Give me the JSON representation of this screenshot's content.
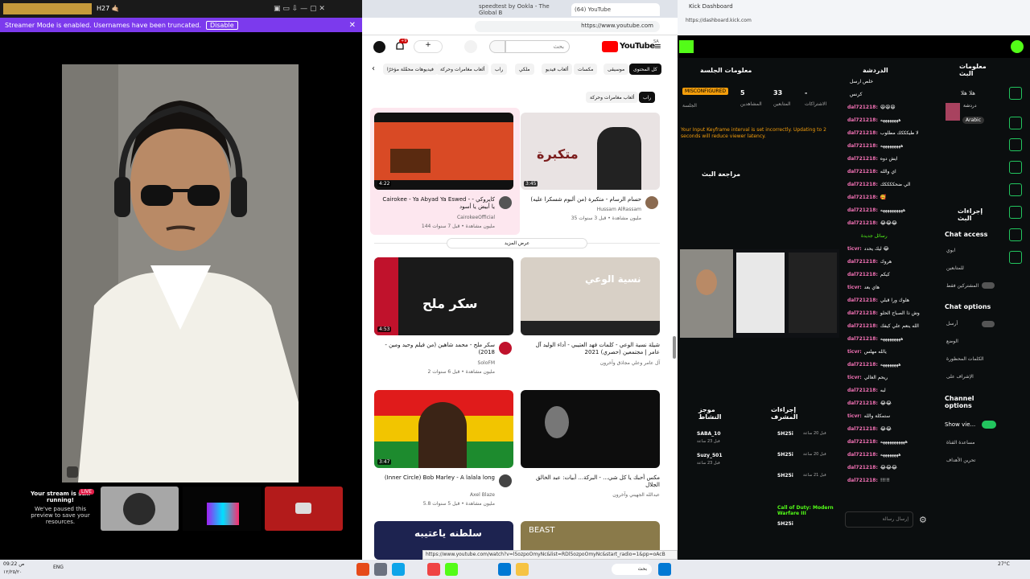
{
  "studio": {
    "title": "H27 🤙🏼",
    "banner": "Streamer Mode is enabled. Usernames have been truncated.",
    "disable": "Disable",
    "stream_msg_title": "Your stream is still running!",
    "stream_msg_body": "We've paused this preview to save your resources.",
    "live": "LIVE"
  },
  "browser": {
    "tabs": [
      "speedtest by Ookla - The Global B",
      "(64) YouTube"
    ],
    "url": "https://www.youtube.com",
    "search_placeholder": "بحث",
    "bell_count": "+9",
    "yt_logo": "YouTube",
    "yt_sup": "SA",
    "chips": [
      "كل المحتوى",
      "موسيقى",
      "مكسات",
      "ألعاب فيديو",
      "ملكي",
      "راب",
      "ألعاب مغامرات وحركة",
      "فيديوهات محمَّلة مؤخرًا"
    ],
    "subchips": [
      "راب",
      "ألعاب مغامرات وحركة"
    ],
    "show_more": "عرض المزيد",
    "videos": [
      {
        "title": "Cairokee - Ya Abyad Ya Eswed - كايروكي - يا أبيض يا أسود",
        "channel": "CairokeeOfficial",
        "meta": "144 مليون مشاهدة • قبل 7 سنوات",
        "dur": "4:22"
      },
      {
        "title": "حسام الرسام - متكبرة (من ألبوم شسكرا عليه)",
        "channel": "Hussam AlRassam",
        "meta": "35 مليون مشاهدة • قبل 3 سنوات",
        "dur": "3:45"
      },
      {
        "title": "سكر ملح - محمد شاهين (من فيلم وحيد ومين - 2018)",
        "channel": "SoloFM",
        "meta": "2 مليون مشاهدة • قبل 6 سنوات",
        "dur": "4:53"
      },
      {
        "title": "شيلة نسية الوعي - كلمات فهد العتيبي - أداء الوليد آل عامر | مجتمعين (حصري) 2021",
        "channel": "آل عامر وعلي مجاذق وآخرون",
        "meta": "",
        "dur": ""
      },
      {
        "title": "(Inner Circle) Bob Marley - A lalala long",
        "channel": "Axel Blaze",
        "meta": "5.8 مليون مشاهدة • قبل 5 سنوات",
        "dur": "3:47"
      },
      {
        "title": "مكس أحبك يا كل شي... - البركة... أبيات: عبد الخالق الجلال",
        "channel": "عبدالله الجهيني وآخرون",
        "meta": "",
        "dur": ""
      }
    ],
    "status_url": "https://www.youtube.com/watch?v=l5ozpoOmyNc&list=RDl5ozpoOmyNc&start_radio=1&pp=oAcB",
    "thumb_texts": [
      "متكبرة",
      "سكر ملح",
      "نسية الوعي",
      "سلطنه ياعتيبه",
      "BEAST"
    ]
  },
  "kick": {
    "tab_title": "Kick Dashboard",
    "url": "https://dashboard.kick.com",
    "session_title": "معلومات الجلسة",
    "chat_title": "الدردشة",
    "stream_info_title": "معلومات البث",
    "misconfigured": "MISCONFIGURED",
    "stat_viewers": "5",
    "stat_viewers_label": "المشاهدين",
    "stat_followers": "33",
    "stat_followers_label": "المتابعين",
    "stat_subs": "-",
    "stat_subs_label": "الاشتراكات",
    "session_label": "الجلسة",
    "warning": "Your Input Keyframe interval is set incorrectly. Updating to 2 seconds will reduce viewer latency.",
    "review_title": "مراجعة البث",
    "stream_title": "هلا هلا",
    "category": "دردشة",
    "lang": "Arabic",
    "chat_messages": [
      {
        "u": "",
        "t": "خلص ارسل"
      },
      {
        "u": "",
        "t": "كرنس"
      },
      {
        "u": "dal721218:",
        "t": "😆😆😆"
      },
      {
        "u": "dal721218:",
        "t": "ههههههههه"
      },
      {
        "u": "dal721218:",
        "t": "لا طيكككك مطلوب"
      },
      {
        "u": "dal721218:",
        "t": "هههههههههه"
      },
      {
        "u": "dal721218:",
        "t": "ايش دوه"
      },
      {
        "u": "dal721218:",
        "t": "اي والله"
      },
      {
        "u": "dal721218:",
        "t": "الي ضحككككك"
      },
      {
        "u": "dal721218:",
        "t": "🥰"
      },
      {
        "u": "dal721218:",
        "t": "ههههههههههه"
      },
      {
        "u": "dal721218:",
        "t": "😂😂😂"
      }
    ],
    "new_msgs": "رسائل جديدة",
    "chat_messages2": [
      {
        "u": "ticvr:",
        "t": "ليك يحدد 😂"
      },
      {
        "u": "dal721218:",
        "t": "هروك"
      },
      {
        "u": "dal721218:",
        "t": "كيكم"
      },
      {
        "u": "ticvr:",
        "t": "هاي بعد"
      },
      {
        "u": "dal721218:",
        "t": "هلوك ورا قبلي"
      },
      {
        "u": "dal721218:",
        "t": "وش ذا الصباح الحلو"
      },
      {
        "u": "dal721218:",
        "t": "الله ينعم علي كيفك"
      },
      {
        "u": "dal721218:",
        "t": "هههههههههه"
      },
      {
        "u": "ticvr:",
        "t": "يالله مهلس"
      },
      {
        "u": "dal721218:",
        "t": "ههههههههه"
      },
      {
        "u": "ticvr:",
        "t": "ريحم الغالي"
      },
      {
        "u": "dal721218:",
        "t": "لبه"
      },
      {
        "u": "dal721218:",
        "t": "😂😂"
      },
      {
        "u": "ticvr:",
        "t": "ستمكلة والله"
      },
      {
        "u": "dal721218:",
        "t": "😂😂"
      },
      {
        "u": "dal721218:",
        "t": "هههههههههههه"
      },
      {
        "u": "dal721218:",
        "t": "ههههههههه"
      },
      {
        "u": "dal721218:",
        "t": "😂😂😂"
      },
      {
        "u": "dal721218:",
        "t": "!!!!!"
      }
    ],
    "send_placeholder": "إرسال رسالة",
    "actions_title": "إجراءات البث",
    "chat_access": "Chat access",
    "chat_options": "Chat options",
    "channel_options": "Channel options",
    "show_viewers": "Show vie...",
    "chat_access_items": [
      "ابوي",
      "للمتابعين",
      "المشتركين فقط"
    ],
    "chat_options_items": [
      "أرسل",
      "الوضع",
      "الكلمات المحظورة",
      "الإشراف على"
    ],
    "channel_items": [
      "مساعدة القناة",
      "تحرين الأهداف"
    ],
    "mod_title": "إجراءات المشرف",
    "viewers_title": "موجز النشاط",
    "mod_items": [
      {
        "u": "SH25i",
        "t": "قبل 20 ساعة"
      },
      {
        "u": "SH25i",
        "t": "قبل 20 ساعة"
      },
      {
        "u": "SH25i",
        "t": "قبل 21 ساعة"
      },
      {
        "u": "SH25i",
        "t": "Call of Duty: Modern Warfare III"
      }
    ],
    "viewer_items": [
      {
        "u": "SABA_10",
        "t": "قبل 23 ساعة"
      },
      {
        "u": "Suzy_501",
        "t": "قبل 23 ساعة"
      }
    ]
  },
  "taskbar": {
    "time": "09:22 ص",
    "date": "١٢/٢٥/٢٠",
    "temp": "27°C",
    "lang": "ENG",
    "search": "بحث"
  },
  "colors": {
    "kick_green": "#53fc18",
    "youtube_red": "#ff0000",
    "streamer_purple": "#7c3aed"
  }
}
